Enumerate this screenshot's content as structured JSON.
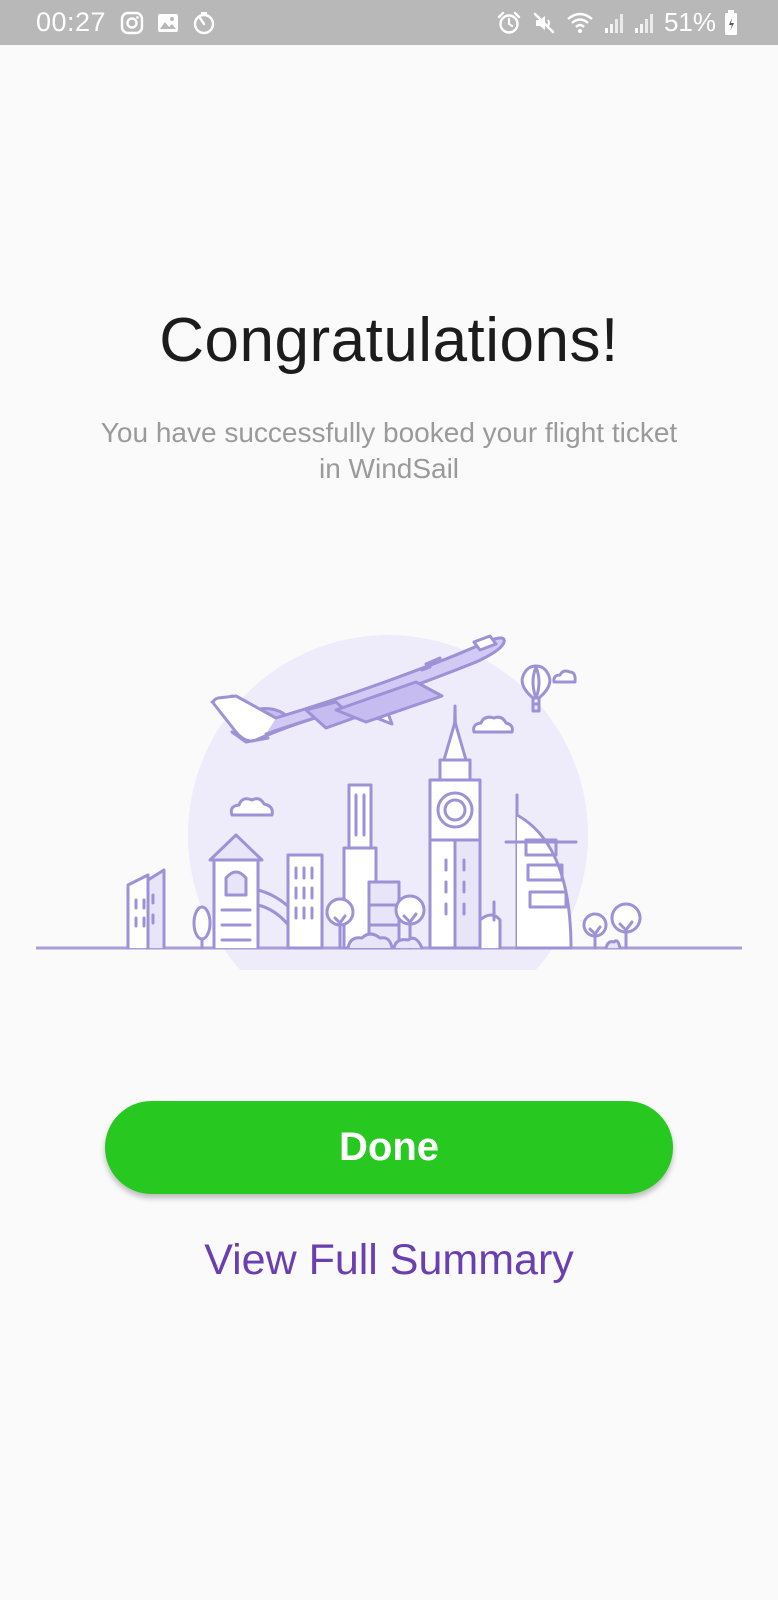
{
  "status_bar": {
    "time": "00:27",
    "battery_percent": "51%",
    "left_icons": [
      "instagram-icon",
      "gallery-icon",
      "timer-icon"
    ],
    "right_icons": [
      "alarm-icon",
      "mute-icon",
      "wifi-icon",
      "signal-icon",
      "signal-icon",
      "battery-icon"
    ]
  },
  "congrats": {
    "title": "Congratulations!",
    "message": "You have successfully booked your flight ticket in WindSail"
  },
  "illustration": {
    "subject": "airplane-city-skyline",
    "accent_color": "#9e92d6",
    "fill_color": "#e9e5f9"
  },
  "actions": {
    "done_label": "Done",
    "done_color": "#27c81f",
    "summary_label": "View Full Summary",
    "summary_color": "#6a3fb0"
  }
}
